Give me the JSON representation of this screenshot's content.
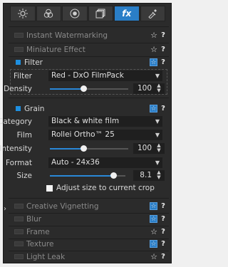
{
  "toolbar": {
    "tabs": [
      {
        "icon": "sun-icon"
      },
      {
        "icon": "color-circles-icon"
      },
      {
        "icon": "target-icon"
      },
      {
        "icon": "layers-icon"
      },
      {
        "icon": "fx-icon",
        "label": "fx",
        "active": true
      },
      {
        "icon": "eyedropper-icon"
      }
    ]
  },
  "effects": {
    "instant_watermarking": "Instant Watermarking",
    "miniature_effect": "Miniature Effect",
    "filter": "Filter",
    "grain": "Grain",
    "creative_vignetting": "Creative Vignetting",
    "blur": "Blur",
    "frame": "Frame",
    "texture": "Texture",
    "light_leak": "Light Leak"
  },
  "filter_params": {
    "filter_label": "Filter",
    "filter_value": "Red - DxO FilmPack",
    "density_label": "Density",
    "density_value": "100",
    "density_fraction": 0.43
  },
  "grain_params": {
    "category_label": "Category",
    "category_value": "Black & white film",
    "film_label": "Film",
    "film_value": "Rollei Ortho™ 25",
    "intensity_label": "Intensity",
    "intensity_value": "100",
    "intensity_fraction": 0.43,
    "format_label": "Format",
    "format_value": "Auto - 24x36",
    "size_label": "Size",
    "size_value": "8.1",
    "size_fraction": 0.84,
    "adjust_label": "Adjust size to current crop"
  },
  "glyphs": {
    "star": "☆",
    "help": "?",
    "caret": "▼",
    "side_arrow": "›"
  }
}
